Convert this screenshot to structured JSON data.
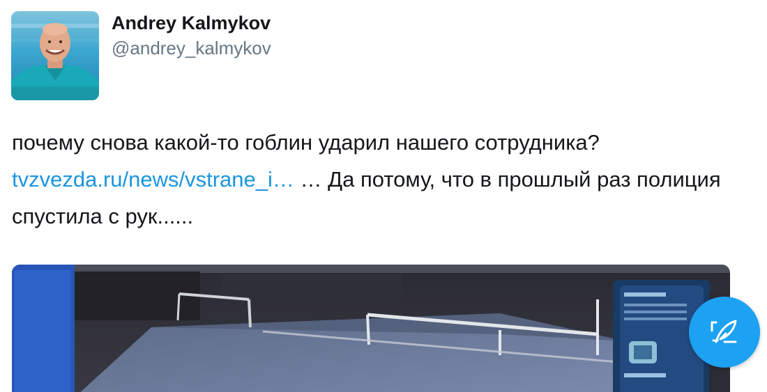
{
  "user": {
    "display_name": "Andrey Kalmykov",
    "handle": "@andrey_kalmykov"
  },
  "tweet": {
    "text_part1": "почему снова какой-то гоблин ударил нашего сотрудника?",
    "link": "tvzvezda.ru/news/vstrane_i…",
    "text_part2": " … Да потому, что в прошлый раз полиция спустила с рук......"
  },
  "colors": {
    "link": "#1b95e0",
    "fab": "#1da1f2"
  },
  "icons": {
    "compose": "compose-feather-icon"
  }
}
